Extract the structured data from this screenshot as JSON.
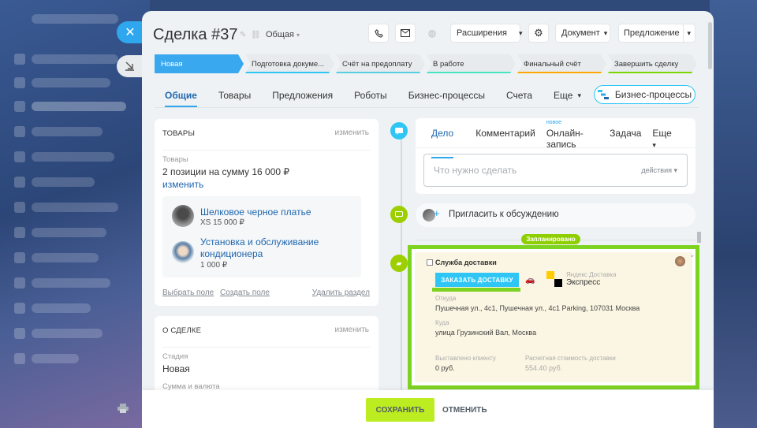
{
  "header": {
    "title": "Сделка #37",
    "category": "Общая",
    "buttons": {
      "extensions": "Расширения",
      "document": "Документ",
      "proposal": "Предложение"
    }
  },
  "stages": [
    {
      "label": "Новая",
      "color": "#39a8ef",
      "active": true
    },
    {
      "label": "Подготовка докуме...",
      "color": "#2fc6f6"
    },
    {
      "label": "Счёт на предоплату",
      "color": "#55d0e0"
    },
    {
      "label": "В работе",
      "color": "#47e4c2"
    },
    {
      "label": "Финальный счёт",
      "color": "#ffa900"
    },
    {
      "label": "Завершить сделку",
      "color": "#7bd500"
    }
  ],
  "tabs": [
    "Общие",
    "Товары",
    "Предложения",
    "Роботы",
    "Бизнес-процессы",
    "Счета",
    "Еще"
  ],
  "bp_button": "Бизнес-процессы",
  "goods_card": {
    "title": "ТОВАРЫ",
    "action": "изменить",
    "label": "Товары",
    "summary": "2 позиции на сумму 16 000 ₽",
    "edit_link": "изменить",
    "items": [
      {
        "name": "Шелковое черное платье",
        "meta": "XS   15 000 ₽"
      },
      {
        "name_line1": "Установка и обслуживание",
        "name_line2": "кондиционера",
        "meta": "1 000 ₽"
      }
    ],
    "footer": {
      "select": "Выбрать поле",
      "create": "Создать поле",
      "delete": "Удалить раздел"
    }
  },
  "deal_card": {
    "title": "О СДЕЛКЕ",
    "action": "изменить",
    "stage_label": "Стадия",
    "stage_value": "Новая",
    "sum_label": "Сумма и валюта"
  },
  "activity": {
    "tabs": [
      "Дело",
      "Комментарий",
      "Онлайн-запись",
      "Задача",
      "Еще"
    ],
    "new_badge": "новое",
    "placeholder": "Что нужно сделать",
    "actions": "действия"
  },
  "invite": "Пригласить к обсуждению",
  "planned_badge": "Запланировано",
  "delivery": {
    "title": "Служба доставки",
    "order_button": "ЗАКАЗАТЬ ДОСТАВКУ",
    "service_small": "Яндекс Доставка",
    "service_name": "Экспресс",
    "from_label": "Откуда",
    "from_value": "Пушечная ул., 4с1, Пушечная ул., 4с1 Parking, 107031 Москва",
    "to_label": "Куда",
    "to_value": "улица Грузинский Вал, Москва",
    "client_label": "Выставлено клиенту",
    "client_value": "0 руб.",
    "cost_label": "Расчетная стоимость доставки",
    "cost_value": "554.40 руб."
  },
  "footer": {
    "save": "СОХРАНИТЬ",
    "cancel": "ОТМЕНИТЬ"
  }
}
